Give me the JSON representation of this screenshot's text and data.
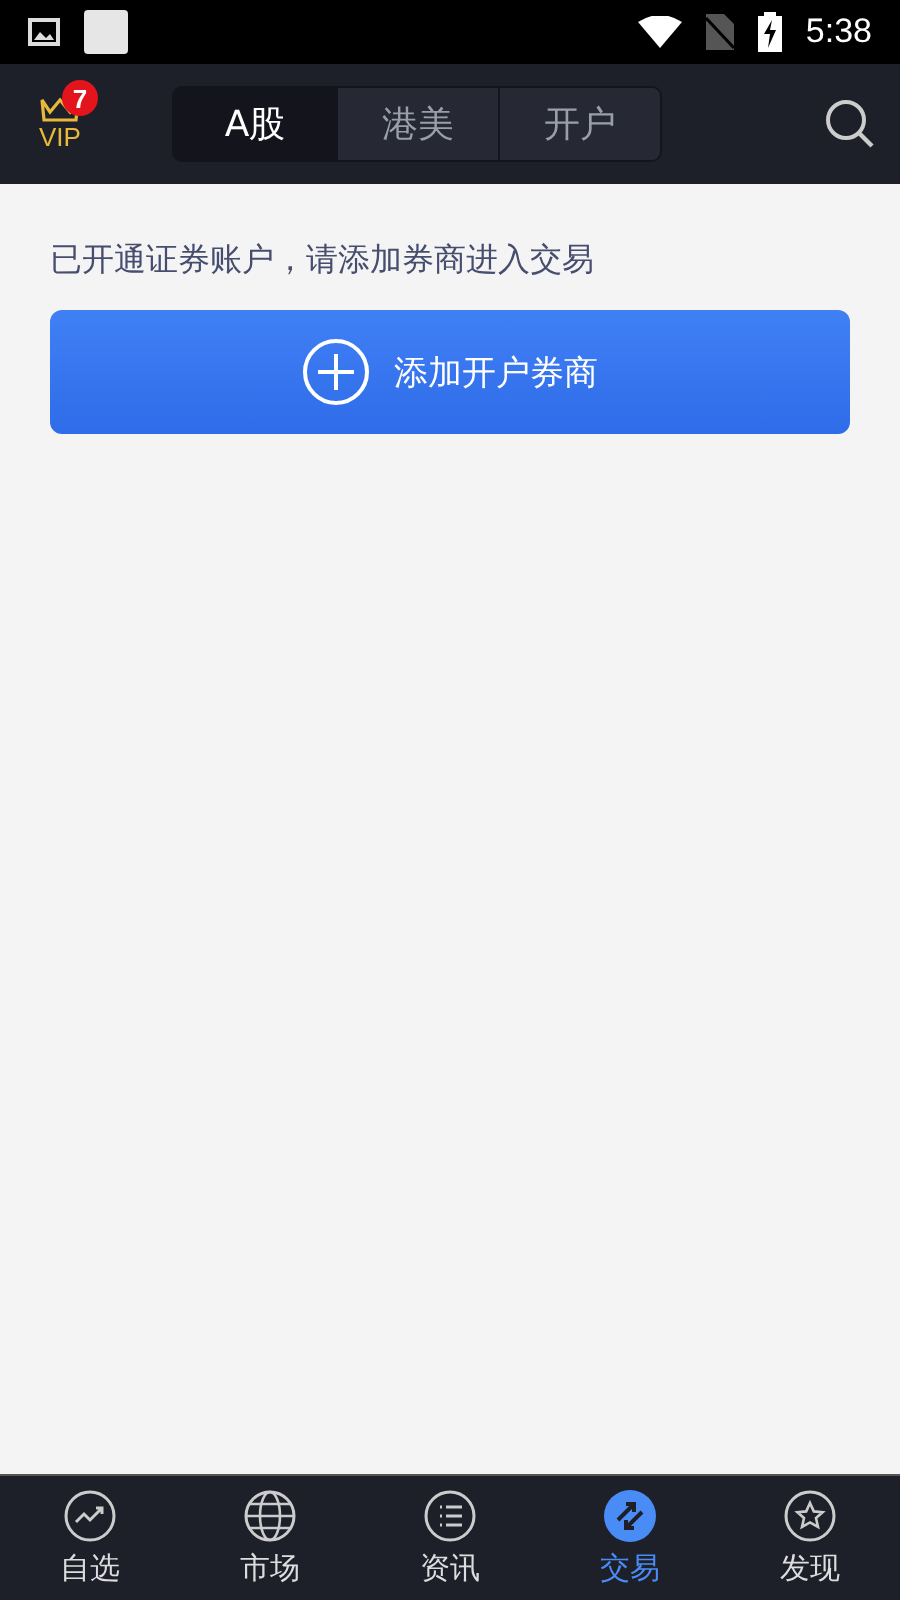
{
  "status_bar": {
    "time": "5:38"
  },
  "header": {
    "vip": {
      "label": "VIP",
      "badge": "7"
    },
    "tabs": [
      {
        "label": "A股",
        "selected": true
      },
      {
        "label": "港美",
        "selected": false
      },
      {
        "label": "开户",
        "selected": false
      }
    ]
  },
  "content": {
    "message": "已开通证券账户，请添加券商进入交易",
    "add_button": "添加开户券商"
  },
  "bottom_nav": [
    {
      "label": "自选",
      "kind": "chart",
      "selected": false
    },
    {
      "label": "市场",
      "kind": "globe",
      "selected": false
    },
    {
      "label": "资讯",
      "kind": "list",
      "selected": false
    },
    {
      "label": "交易",
      "kind": "trade",
      "selected": true
    },
    {
      "label": "发现",
      "kind": "star",
      "selected": false
    }
  ]
}
